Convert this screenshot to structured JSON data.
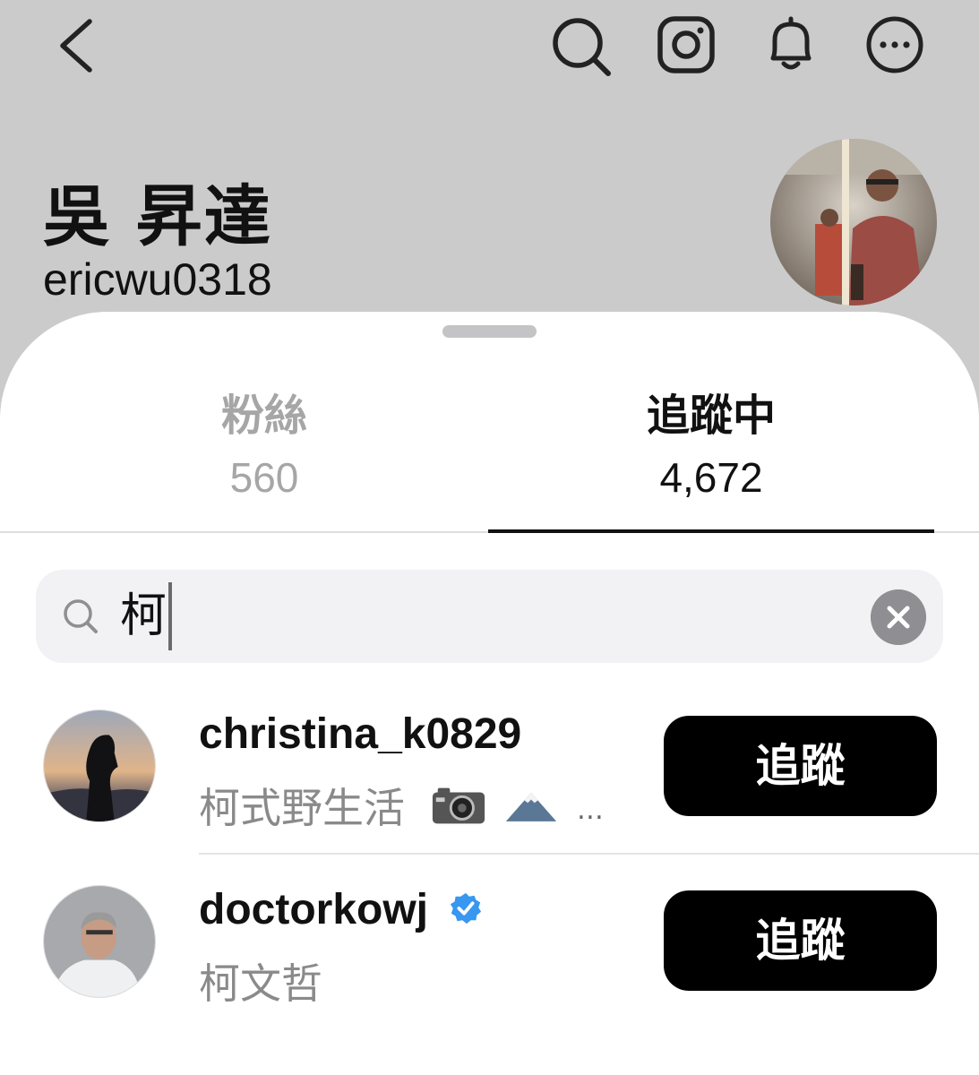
{
  "profile": {
    "name": "吳 昇達",
    "username": "ericwu0318"
  },
  "tabs": [
    {
      "label": "粉絲",
      "count": "560",
      "active": false
    },
    {
      "label": "追蹤中",
      "count": "4,672",
      "active": true
    }
  ],
  "search": {
    "query": "柯"
  },
  "results": [
    {
      "username": "christina_k0829",
      "subtitle": "柯式野生活",
      "subtitle_emoji": [
        "camera",
        "mountain"
      ],
      "ellipsis": "…",
      "verified": false,
      "button_label": "追蹤"
    },
    {
      "username": "doctorkowj",
      "subtitle": "柯文哲",
      "verified": true,
      "button_label": "追蹤"
    }
  ],
  "icons": [
    "back-icon",
    "search-icon",
    "instagram-icon",
    "bell-icon",
    "more-icon",
    "clear-icon",
    "verified-badge-icon"
  ],
  "colors": {
    "header_background": "#cbcbcb",
    "sheet_background": "#ffffff",
    "follow_button": "#000000",
    "verified_badge": "#3897f0",
    "inactive_tab": "#a6a6a6"
  }
}
